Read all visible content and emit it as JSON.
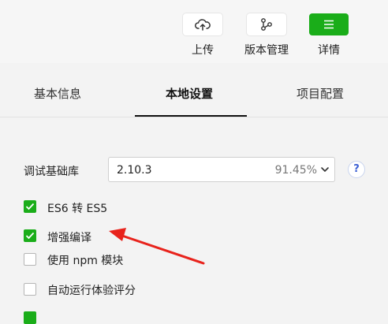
{
  "toolbar": {
    "upload": {
      "label": "上传",
      "icon": "cloud-upload-icon"
    },
    "version": {
      "label": "版本管理",
      "icon": "branch-icon"
    },
    "details": {
      "label": "详情",
      "icon": "menu-icon"
    }
  },
  "tabs": [
    {
      "label": "基本信息",
      "active": false
    },
    {
      "label": "本地设置",
      "active": true
    },
    {
      "label": "项目配置",
      "active": false
    }
  ],
  "debug_lib": {
    "label": "调试基础库",
    "version": "2.10.3",
    "coverage": "91.45%",
    "help": "?"
  },
  "options": [
    {
      "label": "ES6 转 ES5",
      "checked": true
    },
    {
      "label": "增强编译",
      "checked": true
    },
    {
      "label": "使用 npm 模块",
      "checked": false
    },
    {
      "label": "自动运行体验评分",
      "checked": false
    }
  ],
  "colors": {
    "accent": "#1aad19",
    "arrow": "#e8231c",
    "help": "#3b5fd4"
  }
}
